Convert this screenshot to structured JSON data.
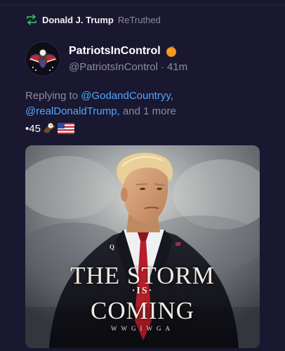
{
  "retruth": {
    "user": "Donald J. Trump",
    "action": "ReTruthed",
    "icon": "retruth-arrows-icon",
    "icon_color": "#2fb45c"
  },
  "author": {
    "display_name": "PatriotsInControl",
    "badge_icon": "orange-emoji-icon",
    "handle": "@PatriotsInControl",
    "separator": "·",
    "time": "41m"
  },
  "reply": {
    "prefix": "Replying to",
    "mentions": [
      "@GodandCountryy,",
      "@realDonaldTrump,"
    ],
    "suffix": "and 1 more",
    "mention_color": "#4fa8ff"
  },
  "post": {
    "text": "•45",
    "emojis": [
      "eagle-emoji-icon",
      "us-flag-emoji-icon"
    ]
  },
  "media": {
    "title_line1": "THE STORM",
    "title_line2": "·IS·",
    "title_line3": "COMING",
    "tagline": "WWGIWGA",
    "lapel_letter": "Q"
  },
  "colors": {
    "background": "#1a1730",
    "muted_text": "#8d8aa3",
    "tie_red": "#b81e2a"
  }
}
